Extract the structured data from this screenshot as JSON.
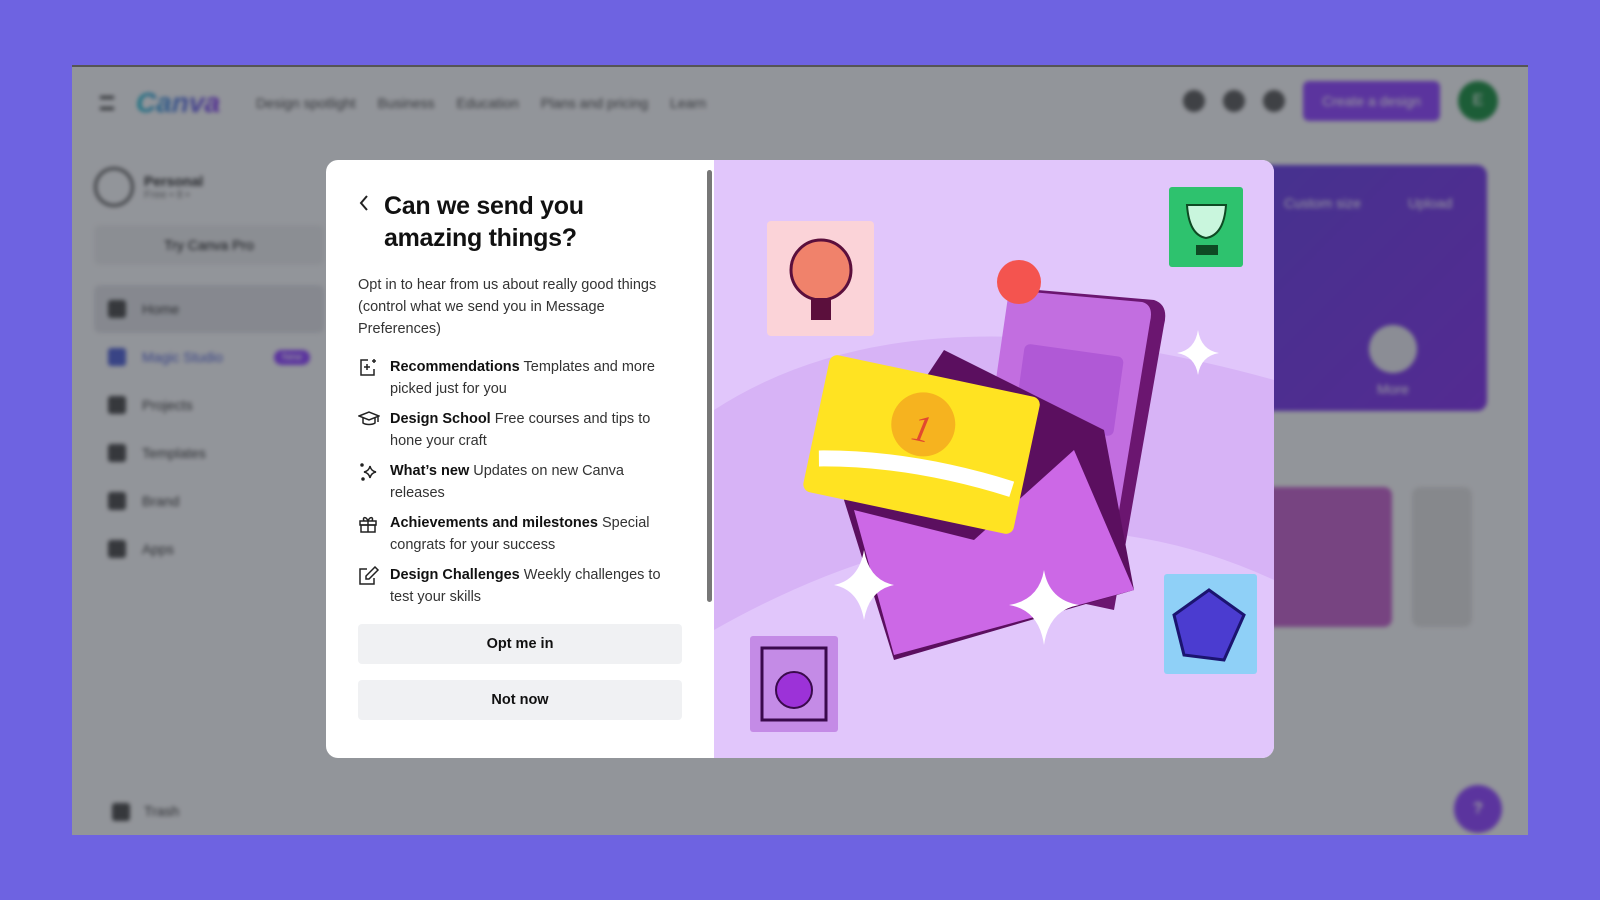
{
  "background_app": {
    "logo": "Canva",
    "nav": [
      "Design spotlight",
      "Business",
      "Education",
      "Plans and pricing",
      "Learn"
    ],
    "create_button": "Create a design",
    "avatar_initial": "E",
    "profile": {
      "name": "Personal",
      "subtitle": "Free • 8 •"
    },
    "try_pro": "Try Canva Pro",
    "sidebar": [
      {
        "label": "Home"
      },
      {
        "label": "Magic Studio",
        "badge": "New"
      },
      {
        "label": "Projects"
      },
      {
        "label": "Templates"
      },
      {
        "label": "Brand"
      },
      {
        "label": "Apps"
      }
    ],
    "trash": "Trash",
    "hero": {
      "custom_size": "Custom size",
      "upload": "Upload",
      "more": "More"
    },
    "help": "?"
  },
  "modal": {
    "title": "Can we send you amazing things?",
    "intro": "Opt in to hear from us about really good things (control what we send you in Message Preferences)",
    "features": [
      {
        "icon": "sparkle-frame-icon",
        "title": "Recommendations",
        "desc": "Templates and more picked just for you"
      },
      {
        "icon": "graduation-cap-icon",
        "title": "Design School",
        "desc": "Free courses and tips to hone your craft"
      },
      {
        "icon": "sparkles-icon",
        "title": "What’s new",
        "desc": "Updates on new Canva releases"
      },
      {
        "icon": "gift-icon",
        "title": "Achievements and milestones",
        "desc": "Special congrats for your success"
      },
      {
        "icon": "edit-icon",
        "title": "Design Challenges",
        "desc": "Weekly challenges to test your skills"
      }
    ],
    "opt_in": "Opt me in",
    "not_now": "Not now"
  },
  "colors": {
    "page_bg": "#6e63e1",
    "illustration_bg": "#e1c6fb",
    "accent": "#8b3dff"
  }
}
